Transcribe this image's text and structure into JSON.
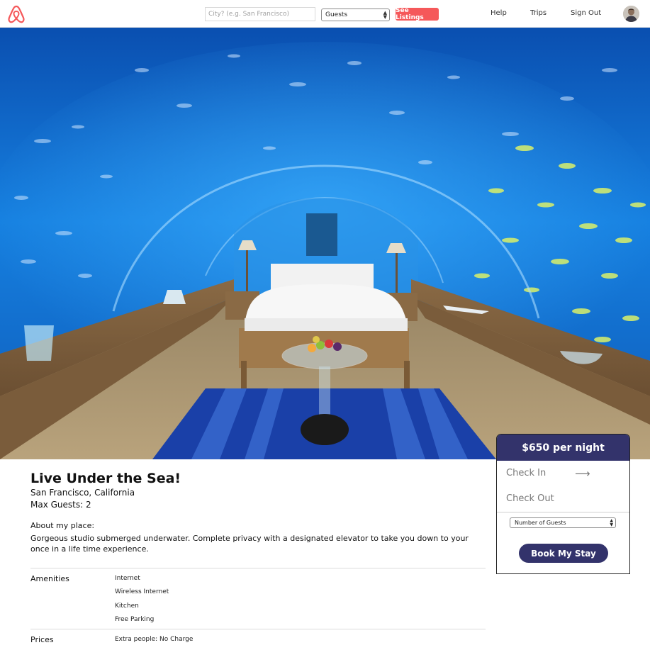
{
  "nav": {
    "search": {
      "placeholder": "City? (e.g. San Francisco)"
    },
    "guests": {
      "selected": "Guests"
    },
    "see_listings_label": "See Listings",
    "links": {
      "help": "Help",
      "trips": "Trips",
      "sign_out": "Sign Out"
    }
  },
  "listing": {
    "title": "Live Under the Sea!",
    "location": "San Francisco, California",
    "max_guests": "Max Guests: 2",
    "about_heading": "About my place:",
    "about_text": "Gorgeous studio submerged underwater. Complete privacy with a designated elevator to take you down to your once in a life time experience.",
    "amenities_label": "Amenities",
    "amenities": [
      "Internet",
      "Wireless Internet",
      "Kitchen",
      "Free Parking"
    ],
    "prices_label": "Prices",
    "prices": [
      "Extra people: No Charge"
    ]
  },
  "booking": {
    "price": "$650 per night",
    "check_in": "Check In",
    "check_out": "Check Out",
    "guests_selected": "Number of Guests",
    "book_label": "Book My Stay"
  },
  "colors": {
    "brand": "#f5585a",
    "accent": "#33336b",
    "water": "#1a6fc4"
  },
  "icons": {
    "logo": "airbnb-logo-icon",
    "arrow": "arrow-right-icon"
  }
}
